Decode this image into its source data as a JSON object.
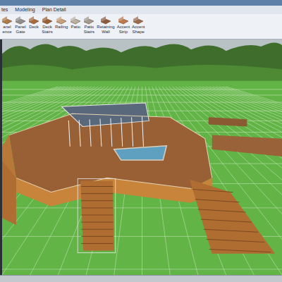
{
  "menu": [
    "tes",
    "Modeling",
    "Plan Detail"
  ],
  "toolbar": [
    {
      "lines": [
        "anel",
        "ence"
      ]
    },
    {
      "lines": [
        "Panel",
        "Gate"
      ]
    },
    {
      "lines": [
        "Deck"
      ]
    },
    {
      "lines": [
        "Deck",
        "Stairs"
      ]
    },
    {
      "lines": [
        "Railing"
      ]
    },
    {
      "lines": [
        "Patio"
      ]
    },
    {
      "lines": [
        "Patio",
        "Stairs"
      ]
    },
    {
      "lines": [
        "Retaining",
        "Wall"
      ]
    },
    {
      "lines": [
        "Accent",
        "Strip"
      ]
    },
    {
      "lines": [
        "Accent",
        "Shape"
      ]
    }
  ]
}
